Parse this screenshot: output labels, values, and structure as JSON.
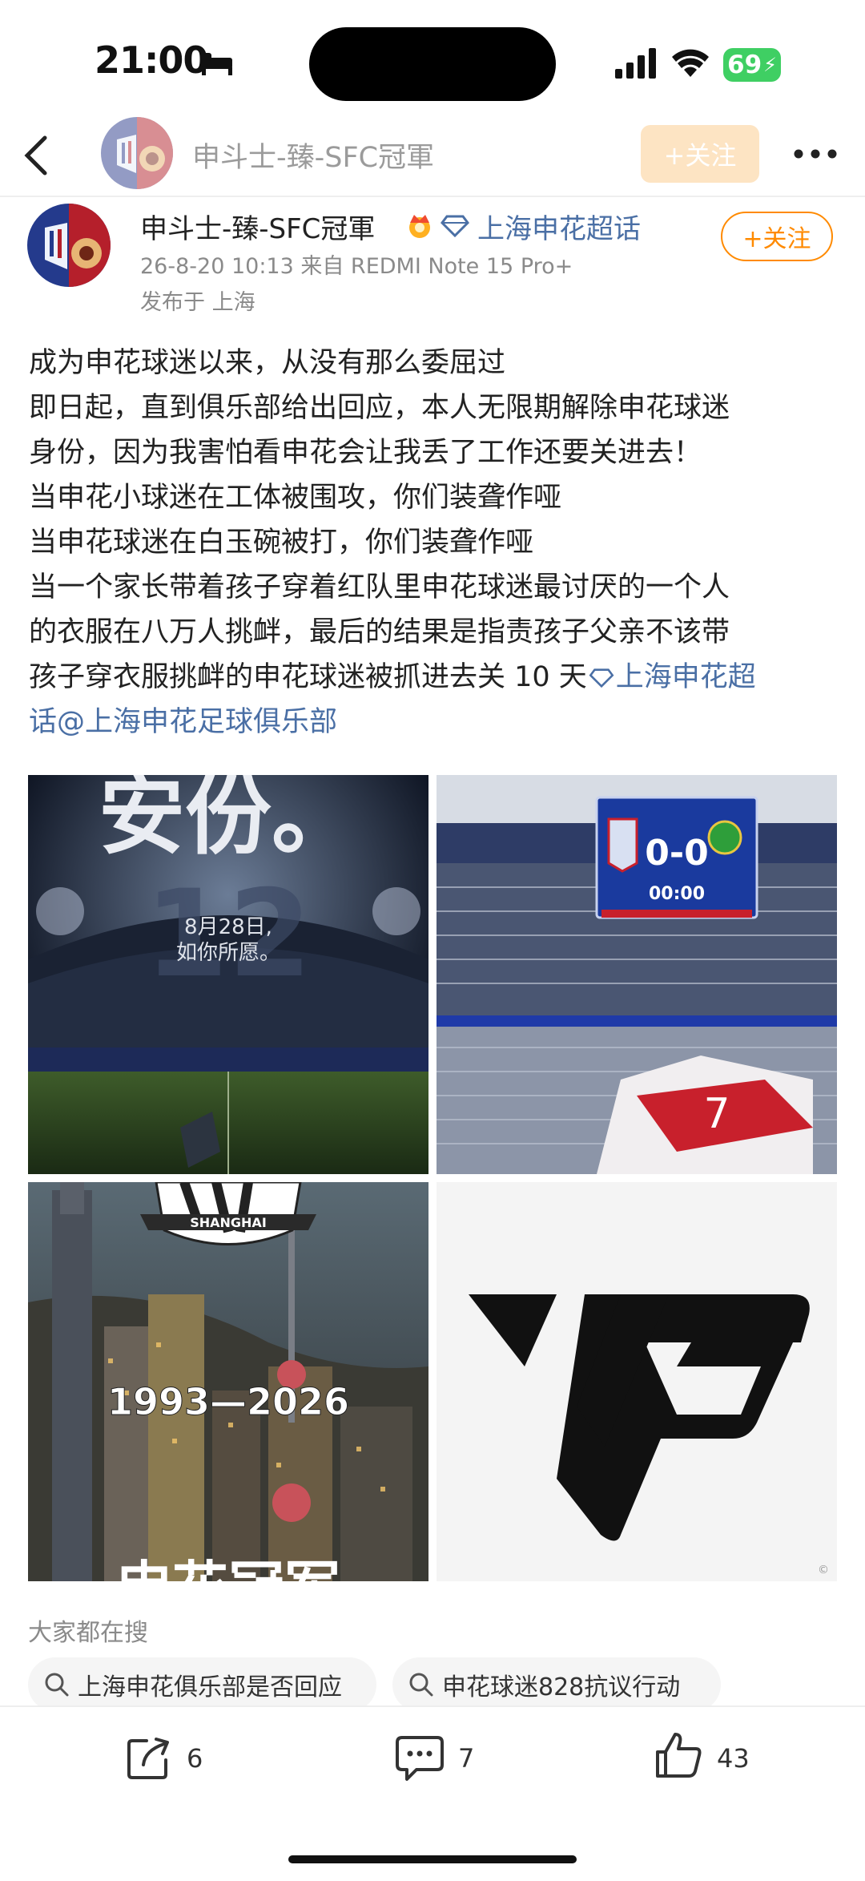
{
  "status_bar": {
    "time": "21:00",
    "battery": "69"
  },
  "header": {
    "title": "申斗士-臻-SFC冠軍",
    "follow_label": "+关注"
  },
  "post": {
    "author": "申斗士-臻-SFC冠軍",
    "topic": "上海申花超话",
    "meta": "26-8-20 10:13  来自 REDMI Note 15 Pro+",
    "location": "发布于 上海",
    "follow_label": "+关注",
    "body_lines": [
      "成为申花球迷以来，从没有那么委屈过",
      "即日起，直到俱乐部给出回应，本人无限期解除申花球迷",
      "身份，因为我害怕看申花会让我丢了工作还要关进去！",
      "当申花小球迷在工体被围攻，你们装聋作哑",
      "当申花球迷在白玉碗被打，你们装聋作哑",
      "当一个家长带着孩子穿着红队里申花球迷最讨厌的一个人",
      "的衣服在八万人挑衅，最后的结果是指责孩子父亲不该带",
      "孩子穿衣服挑衅的申花球迷被抓进去关 10 天"
    ],
    "inline_topic": "上海申花超",
    "last_line_topic": "话",
    "mention": "@上海申花足球俱乐部"
  },
  "images": {
    "img1": {
      "title": "安份。",
      "date": "8月28日,",
      "slogan": "如你所愿。"
    },
    "img2": {
      "score": "0-0",
      "clock": "00:00",
      "shirt_number": "7"
    },
    "img3": {
      "years": "1993—2026",
      "badge_text": "SHANGHAI",
      "bottom_text": "申花冠军"
    },
    "img4": {}
  },
  "search": {
    "title": "大家都在搜",
    "chips": [
      "上海申花俱乐部是否回应",
      "申花球迷828抗议行动"
    ]
  },
  "actions": {
    "share": "6",
    "comment": "7",
    "like": "43"
  },
  "colors": {
    "accent": "#ff8a00",
    "link": "#4a6fa5",
    "battery": "#3fcf63"
  }
}
